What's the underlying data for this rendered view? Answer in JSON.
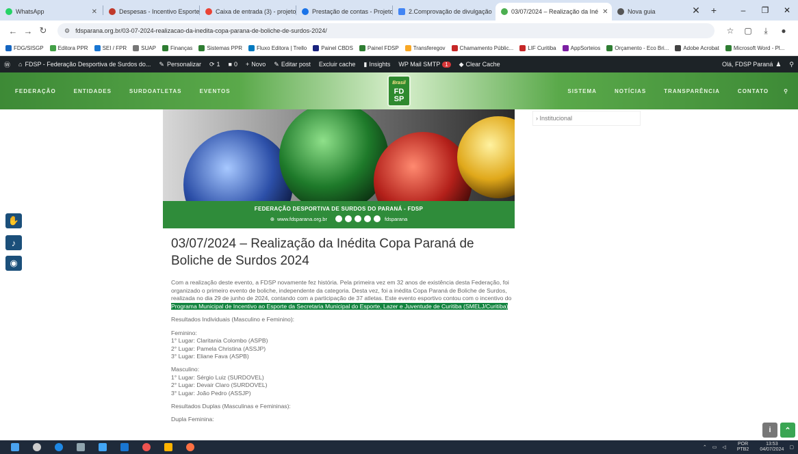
{
  "browser": {
    "tabs": [
      {
        "label": "WhatsApp",
        "color": "#25d366"
      },
      {
        "label": "Despesas - Incentivo Esporte",
        "color": "#c0392b"
      },
      {
        "label": "Caixa de entrada (3) - projetos",
        "color": "#ea4335"
      },
      {
        "label": "Prestação de contas - Projeto",
        "color": "#1a73e8"
      },
      {
        "label": "2.Comprovação de divulgação",
        "color": "#4285f4"
      },
      {
        "label": "03/07/2024 – Realização da Iné",
        "color": "#4caf50",
        "active": true
      },
      {
        "label": "Nova guia",
        "color": "#555555"
      }
    ],
    "url": "fdsparana.org.br/03-07-2024-realizacao-da-inedita-copa-parana-de-boliche-de-surdos-2024/",
    "bookmarks": [
      {
        "label": "FDG/SISGP",
        "color": "#1565c0"
      },
      {
        "label": "Editora PPR",
        "color": "#43a047"
      },
      {
        "label": "SEI / FPR",
        "color": "#1976d2"
      },
      {
        "label": "SUAP",
        "color": "#777777"
      },
      {
        "label": "Finanças",
        "color": "#2e7d32"
      },
      {
        "label": "Sistemas PPR",
        "color": "#2e7d32"
      },
      {
        "label": "Fluxo Editora | Trello",
        "color": "#0079bf"
      },
      {
        "label": "Painel CBDS",
        "color": "#1a237e"
      },
      {
        "label": "Painel FDSP",
        "color": "#2e7d32"
      },
      {
        "label": "Transferegov",
        "color": "#f9a825"
      },
      {
        "label": "Chamamento Públic...",
        "color": "#c62828"
      },
      {
        "label": "LIF Curitiba",
        "color": "#c62828"
      },
      {
        "label": "AppSorteios",
        "color": "#7b1fa2"
      },
      {
        "label": "Orçamento - Eco Bri...",
        "color": "#2e7d32"
      },
      {
        "label": "Adobe Acrobat",
        "color": "#424242"
      },
      {
        "label": "Microsoft Word - Pl...",
        "color": "#2e7d32"
      }
    ]
  },
  "wpbar": {
    "site": "FDSP - Federação Desportiva de Surdos do...",
    "customize": "Personalizar",
    "updates": "1",
    "comments": "0",
    "new": "Novo",
    "edit": "Editar post",
    "cache": "Excluir cache",
    "insights": "Insights",
    "smtp": "WP Mail SMTP",
    "smtp_badge": "1",
    "clear_cache": "Clear Cache",
    "greeting": "Olá, FDSP Paraná"
  },
  "nav": {
    "left": [
      "FEDERAÇÃO",
      "ENTIDADES",
      "SURDOATLETAS",
      "EVENTOS"
    ],
    "right": [
      "SISTEMA",
      "NOTÍCIAS",
      "TRANSPARÊNCIA",
      "CONTATO"
    ],
    "logo_script": "Brasil",
    "logo_lines": [
      "FD",
      "SP"
    ]
  },
  "sidebar": {
    "link": "Institucional"
  },
  "banner": {
    "title": "FEDERAÇÃO DESPORTIVA DE SURDOS DO PARANÁ - FDSP",
    "site": "www.fdsparana.org.br",
    "handle": "fdsparana"
  },
  "article": {
    "title": "03/07/2024 – Realização da Inédita Copa Paraná de Boliche de Surdos 2024",
    "intro": "Com a realização deste evento, a FDSP novamente fez história. Pela primeira vez em 32 anos de existência desta Federação, foi organizado o primeiro evento de boliche, independente da categoria. Desta vez, foi a inédita Copa Paraná de Boliche de Surdos, realizada no dia 29 de junho de 2024, contando com a participação de 37 atletas. Este evento esportivo contou com o incentivo do",
    "intro_highlight": "Programa Municipal de Incentivo ao Esporte da Secretaria Municipal do Esporte, Lazer e Juventude de Curitiba (SMELJ/Curitiba)",
    "results_individual": "Resultados Individuais (Masculino e Feminino):",
    "feminine_label": "Feminino:",
    "feminine": [
      "1° Lugar: Claritania Colombo (ASPB)",
      "2° Lugar: Pamela Christina (ASSJP)",
      "3° Lugar: Eliane Fava (ASPB)"
    ],
    "masculine_label": "Masculino:",
    "masculine": [
      "1° Lugar: Sérgio Luiz (SURDOVEL)",
      "2° Lugar: Devair Claro (SURDOVEL)",
      "3° Lugar: João Pedro (ASSJP)"
    ],
    "results_pairs": "Resultados Duplas (Masculinas e Femininas):",
    "pairs_fem_label": "Dupla Feminina:"
  },
  "taskbar": {
    "lang": "POR",
    "lang2": "PTB2",
    "time": "13:53",
    "date": "04/07/2024"
  }
}
